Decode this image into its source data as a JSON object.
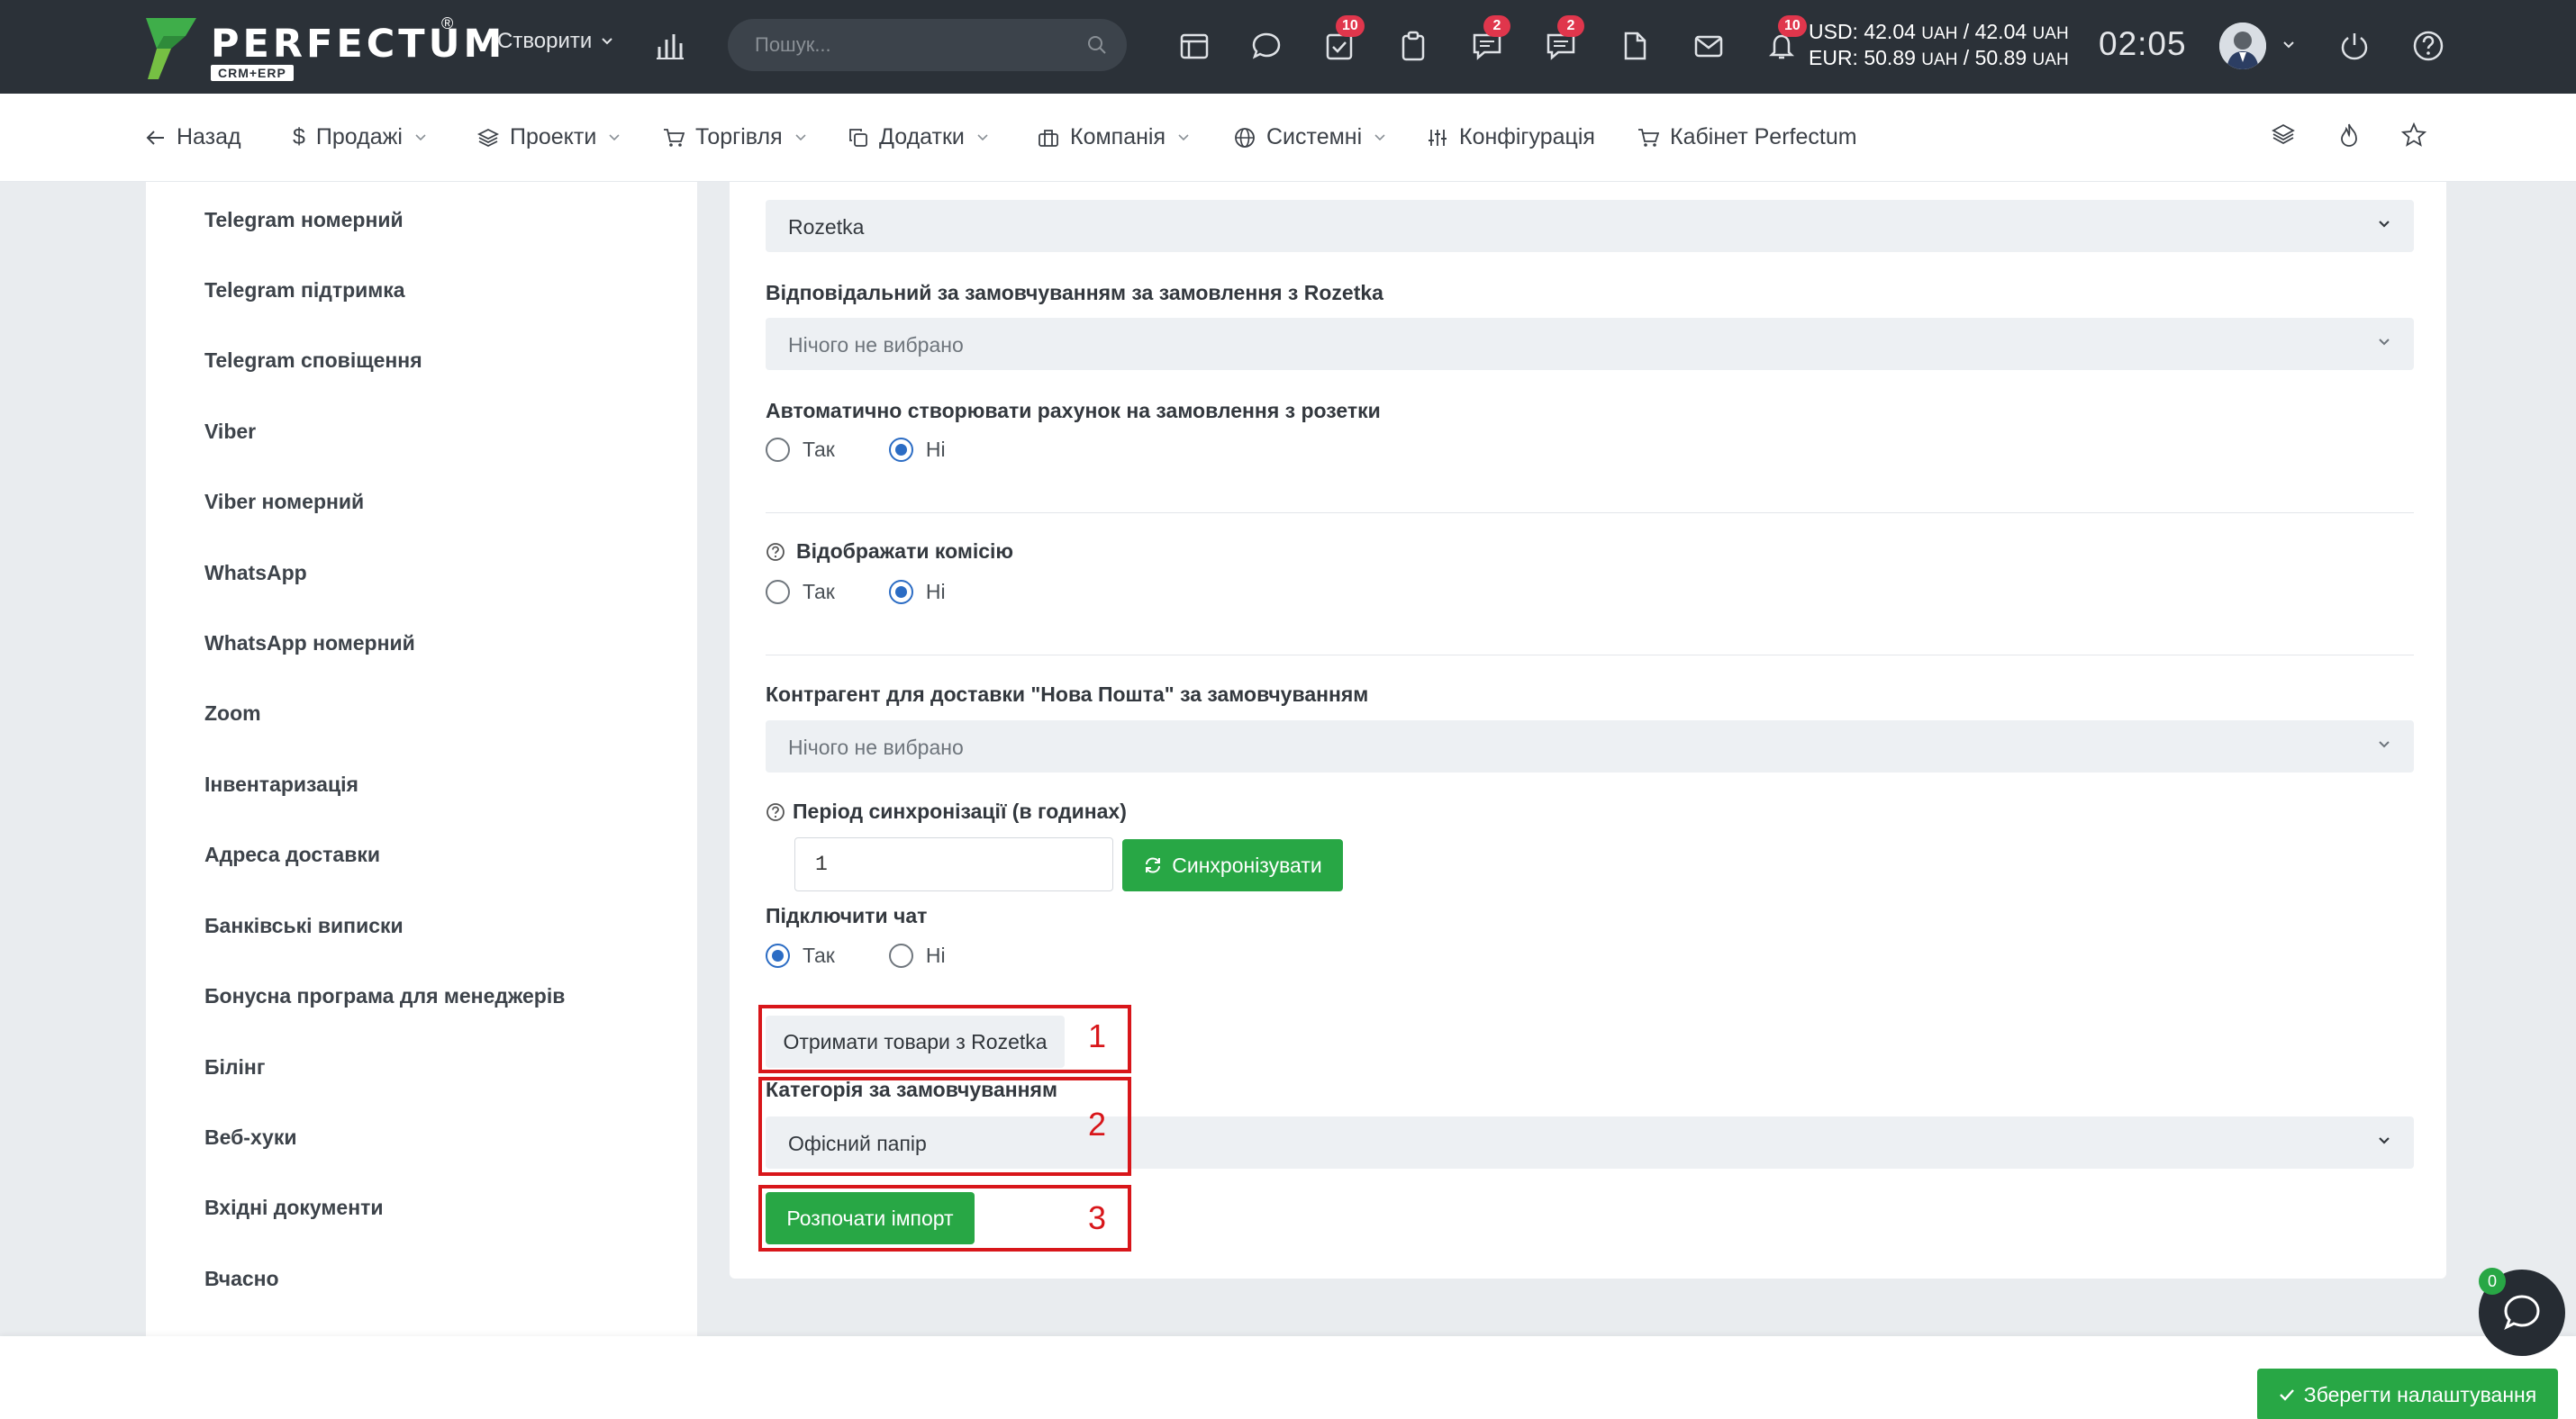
{
  "logo": {
    "name": "PERFECTUM",
    "sub": "CRM+ERP",
    "reg": "®"
  },
  "topbar": {
    "create_label": "Створити",
    "search_placeholder": "Пошук...",
    "badges": {
      "tasks": "10",
      "chat_support": "2",
      "comments": "2",
      "notifications": "10"
    },
    "rates": {
      "usd_label": "USD:",
      "usd_value1": "42.04",
      "usd_value2": "42.04",
      "eur_label": "EUR:",
      "eur_value1": "50.89",
      "eur_value2": "50.89",
      "currency": "UAH"
    },
    "time": "02:05"
  },
  "nav": {
    "back": "Назад",
    "sales": "Продажі",
    "projects": "Проекти",
    "trade": "Торгівля",
    "addons": "Додатки",
    "company": "Компанія",
    "system": "Системні",
    "config": "Конфігурація",
    "cabinet": "Кабінет Perfectum"
  },
  "sidebar": {
    "items": [
      "Telegram номерний",
      "Telegram підтримка",
      "Telegram сповіщення",
      "Viber",
      "Viber номерний",
      "WhatsApp",
      "WhatsApp номерний",
      "Zoom",
      "Інвентаризація",
      "Адреса доставки",
      "Банківські виписки",
      "Бонусна програма для менеджерів",
      "Білінг",
      "Веб-хуки",
      "Вхідні документи",
      "Вчасно"
    ]
  },
  "form": {
    "source_value": "Rozetka",
    "responsible_label": "Відповідальний за замовчуванням за замовлення з Rozetka",
    "responsible_value": "Нічого не вибрано",
    "auto_invoice_label": "Автоматично створювати рахунок на замовлення з розетки",
    "yes": "Так",
    "no": "Ні",
    "show_commission_label": "Відображати комісію",
    "contractor_label": "Контрагент для доставки \"Нова Пошта\" за замовчуванням",
    "contractor_value": "Нічого не вибрано",
    "sync_period_label": "Період синхронізації (в годинах)",
    "sync_period_value": "1",
    "sync_button": "Синхронізувати",
    "connect_chat_label": "Підключити чат",
    "get_products_button": "Отримати товари з Rozetka",
    "default_category_label": "Категорія за замовчуванням",
    "default_category_value": "Офісний папір",
    "start_import_button": "Розпочати імпорт",
    "markers": [
      "1",
      "2",
      "3"
    ]
  },
  "footer": {
    "save_button": "Зберегти налаштування",
    "chat_count": "0"
  },
  "colors": {
    "topbar": "#2b3138",
    "accent_green": "#28a745",
    "radio_blue": "#2b6cc4",
    "annotation_red": "#d8161a",
    "badge_red": "#e0364c"
  }
}
